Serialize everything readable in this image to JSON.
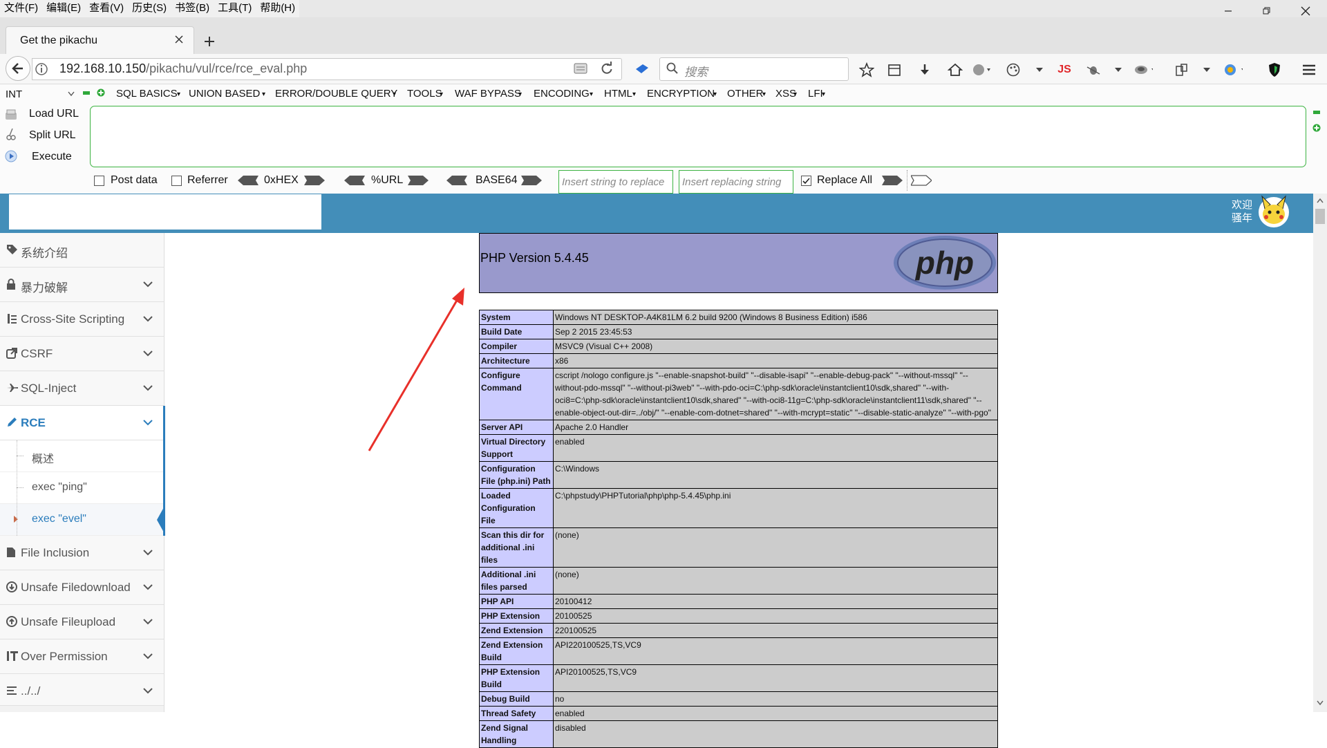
{
  "menubar": {
    "items": [
      "文件(F)",
      "编辑(E)",
      "查看(V)",
      "历史(S)",
      "书签(B)",
      "工具(T)",
      "帮助(H)"
    ]
  },
  "tab": {
    "title": "Get the pikachu"
  },
  "nav": {
    "url_host": "192.168.10.150",
    "url_path": "/pikachu/vul/rce/rce_eval.php",
    "search_placeholder": "搜索"
  },
  "hackbar": {
    "type_select": "INT",
    "menus": [
      "SQL BASICS",
      "UNION BASED",
      "ERROR/DOUBLE QUERY",
      "TOOLS",
      "WAF BYPASS",
      "ENCODING",
      "HTML",
      "ENCRYPTION",
      "OTHER",
      "XSS",
      "LFI"
    ],
    "load_url": "Load URL",
    "split_url": "Split URL",
    "execute": "Execute",
    "input_value": "",
    "post_data": "Post data",
    "referrer": "Referrer",
    "hex": "0xHEX",
    "url_enc": "%URL",
    "base64": "BASE64",
    "replace_placeholder": "Insert string to replace",
    "replacing_placeholder": "Insert replacing string",
    "replace_all": "Replace All",
    "post_data_checked": false,
    "referrer_checked": false,
    "replace_all_checked": true
  },
  "banner": {
    "welcome_line1": "欢迎",
    "welcome_line2": "骚年",
    "color": "#438eb9"
  },
  "sidebar": {
    "items": [
      {
        "label": "系统介绍",
        "icon": "tags-icon"
      },
      {
        "label": "暴力破解",
        "icon": "lock-icon"
      },
      {
        "label": "Cross-Site Scripting",
        "icon": "sitemap-icon"
      },
      {
        "label": "CSRF",
        "icon": "external-link-icon"
      },
      {
        "label": "SQL-Inject",
        "icon": "plane-icon"
      },
      {
        "label": "RCE",
        "icon": "pencil-icon",
        "active": true
      },
      {
        "label": "File Inclusion",
        "icon": "file-icon"
      },
      {
        "label": "Unsafe Filedownload",
        "icon": "download-icon"
      },
      {
        "label": "Unsafe Fileupload",
        "icon": "upload-icon"
      },
      {
        "label": "Over Permission",
        "icon": "text-height-icon"
      },
      {
        "label": "../../",
        "icon": "align-left-icon"
      }
    ],
    "rce_sub": [
      "概述",
      "exec \"ping\"",
      "exec \"evel\""
    ]
  },
  "phpinfo": {
    "version": "PHP Version 5.4.45",
    "logo": "php",
    "rows": [
      [
        "System",
        "Windows NT DESKTOP-A4K81LM 6.2 build 9200 (Windows 8 Business Edition) i586"
      ],
      [
        "Build Date",
        "Sep 2 2015 23:45:53"
      ],
      [
        "Compiler",
        "MSVC9 (Visual C++ 2008)"
      ],
      [
        "Architecture",
        "x86"
      ],
      [
        "Configure Command",
        "cscript /nologo configure.js \"--enable-snapshot-build\" \"--disable-isapi\" \"--enable-debug-pack\" \"--without-mssql\" \"--without-pdo-mssql\" \"--without-pi3web\" \"--with-pdo-oci=C:\\php-sdk\\oracle\\instantclient10\\sdk,shared\" \"--with-oci8=C:\\php-sdk\\oracle\\instantclient10\\sdk,shared\" \"--with-oci8-11g=C:\\php-sdk\\oracle\\instantclient11\\sdk,shared\" \"--enable-object-out-dir=../obj/\" \"--enable-com-dotnet=shared\" \"--with-mcrypt=static\" \"--disable-static-analyze\" \"--with-pgo\""
      ],
      [
        "Server API",
        "Apache 2.0 Handler"
      ],
      [
        "Virtual Directory Support",
        "enabled"
      ],
      [
        "Configuration File (php.ini) Path",
        "C:\\Windows"
      ],
      [
        "Loaded Configuration File",
        "C:\\phpstudy\\PHPTutorial\\php\\php-5.4.45\\php.ini"
      ],
      [
        "Scan this dir for additional .ini files",
        "(none)"
      ],
      [
        "Additional .ini files parsed",
        "(none)"
      ],
      [
        "PHP API",
        "20100412"
      ],
      [
        "PHP Extension",
        "20100525"
      ],
      [
        "Zend Extension",
        "220100525"
      ],
      [
        "Zend Extension Build",
        "API220100525,TS,VC9"
      ],
      [
        "PHP Extension Build",
        "API20100525,TS,VC9"
      ],
      [
        "Debug Build",
        "no"
      ],
      [
        "Thread Safety",
        "enabled"
      ],
      [
        "Zend Signal Handling",
        "disabled"
      ]
    ]
  }
}
